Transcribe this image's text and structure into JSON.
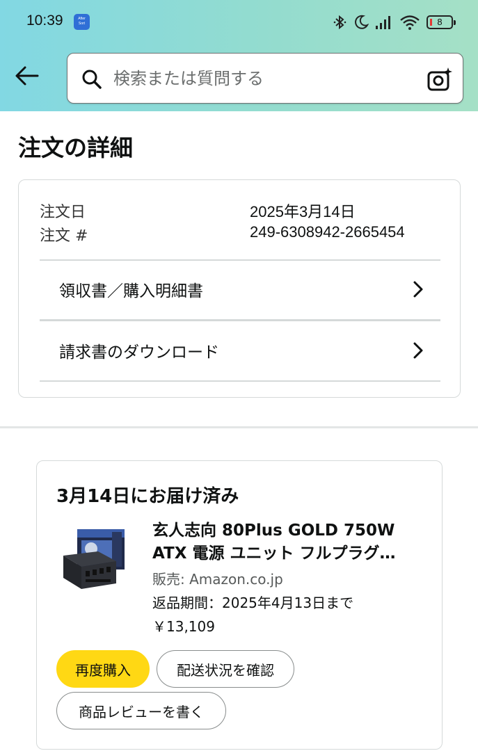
{
  "status_bar": {
    "time": "10:39",
    "notification_app": "AfterSort",
    "battery_level": "8"
  },
  "search": {
    "placeholder": "検索または質問する"
  },
  "page": {
    "title": "注文の詳細"
  },
  "order_info": {
    "order_date_label": "注文日",
    "order_date_value": "2025年3月14日",
    "order_number_label": "注文 #",
    "order_number_value": "249-6308942-2665454",
    "links": [
      {
        "label": "領収書／購入明細書"
      },
      {
        "label": "請求書のダウンロード"
      }
    ]
  },
  "shipment": {
    "status_title": "3月14日にお届け済み",
    "product": {
      "name_line1": "玄人志向 80Plus GOLD 750W",
      "name_line2": "ATX 電源 ユニット フルプラグ…",
      "seller": "販売: Amazon.co.jp",
      "return_period": "返品期間：2025年4月13日まで",
      "price": "￥13,109"
    },
    "buttons": {
      "buy_again": "再度購入",
      "track_package": "配送状況を確認",
      "write_review": "商品レビューを書く"
    }
  },
  "colors": {
    "header_gradient_start": "#82d8e3",
    "header_gradient_end": "#a5e0c6",
    "primary_button": "#ffd814",
    "border": "#d5d9d9"
  }
}
